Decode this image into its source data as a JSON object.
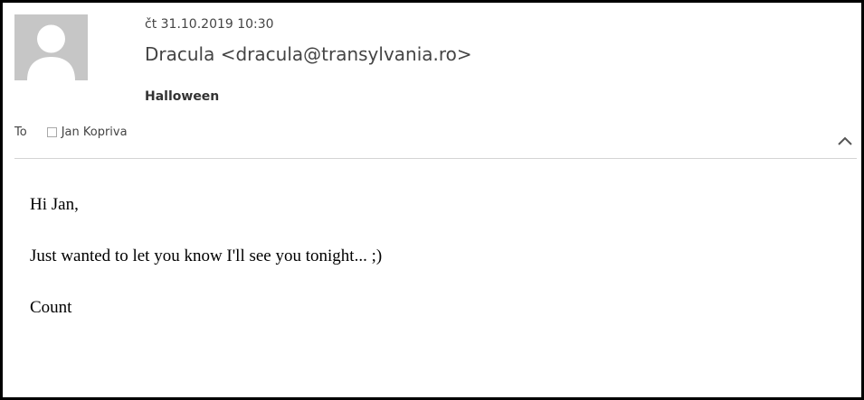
{
  "header": {
    "date": "čt 31.10.2019 10:30",
    "sender": "Dracula <dracula@transylvania.ro>",
    "subject": "Halloween",
    "to_label": "To",
    "recipient": "Jan Kopriva"
  },
  "icons": {
    "avatar": "avatar-placeholder-icon",
    "collapse": "chevron-up-icon",
    "recipient": "checkbox-icon"
  },
  "message": {
    "greeting": "Hi Jan,",
    "text": "Just wanted to let you know I'll see you tonight... ;)",
    "signature": "Count"
  }
}
